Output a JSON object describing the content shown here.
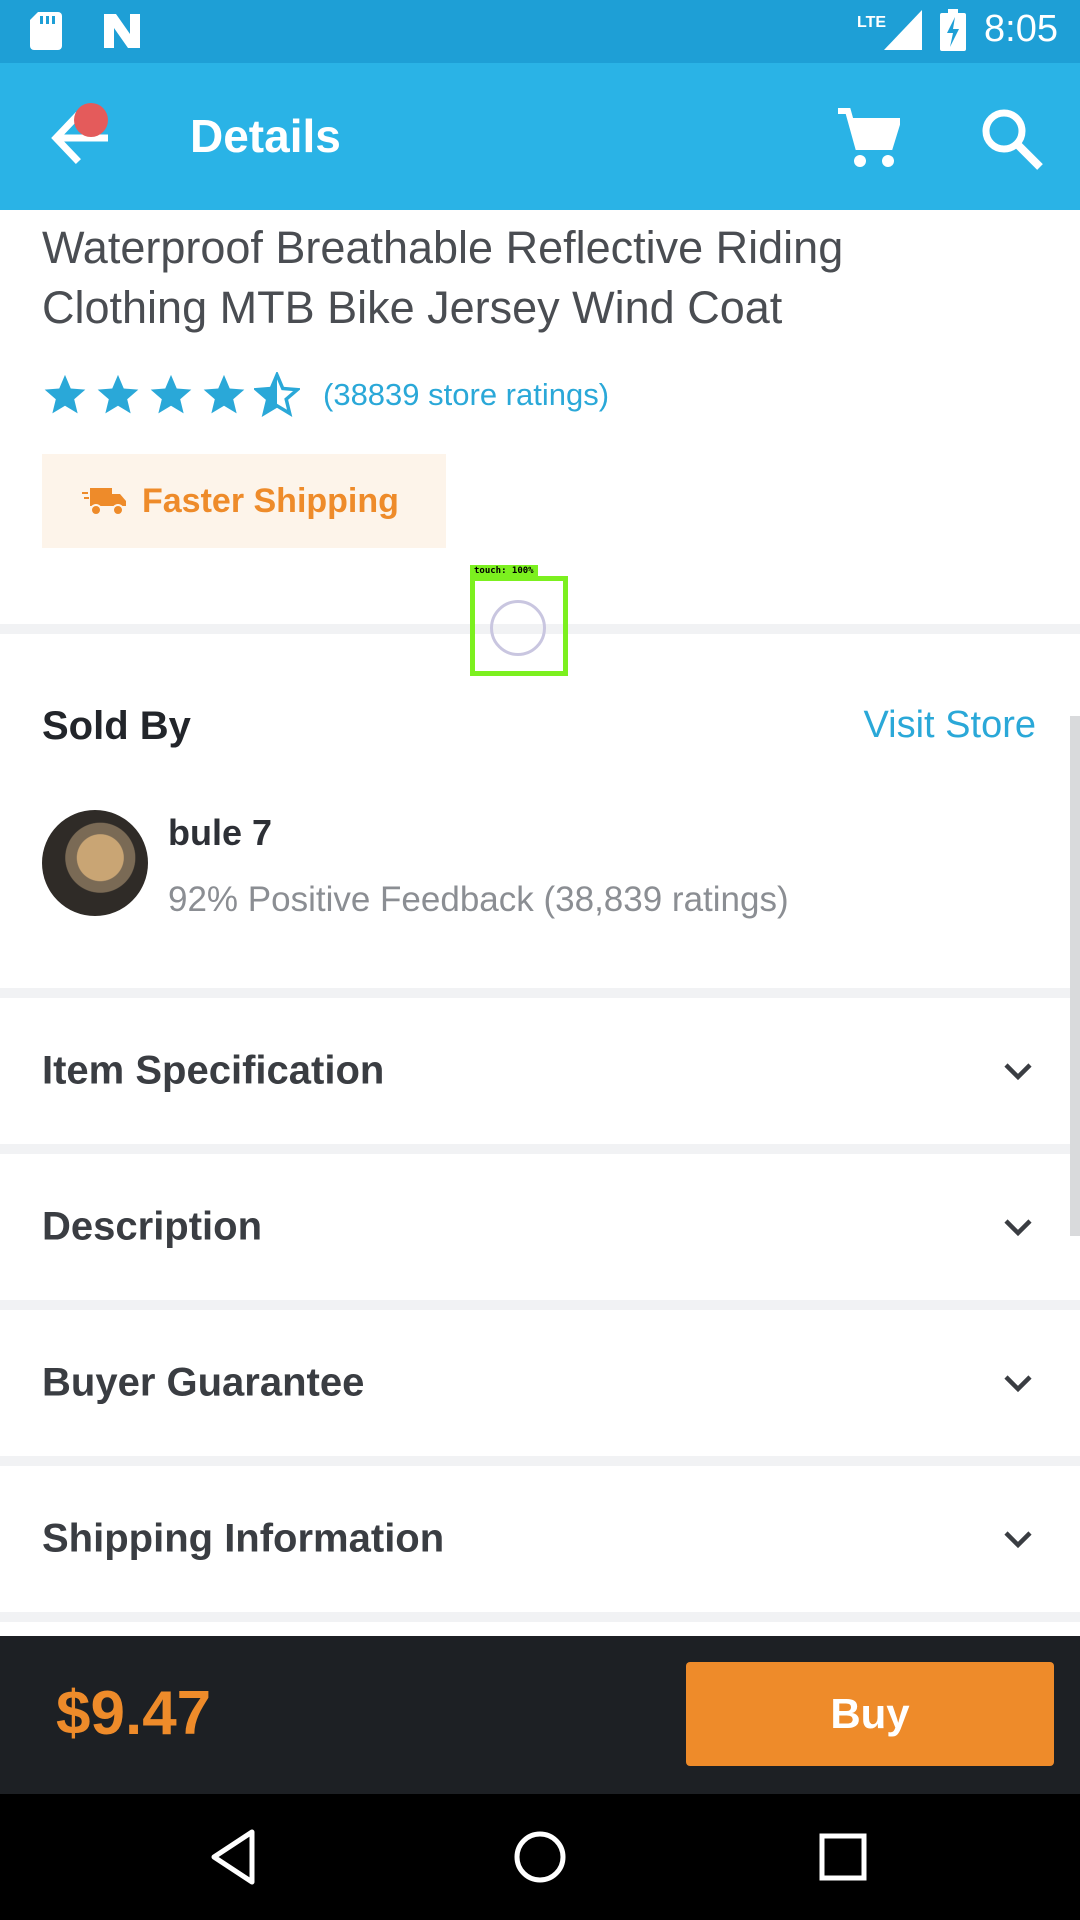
{
  "status_bar": {
    "time": "8:05",
    "network": "LTE",
    "icons": [
      "sd-card-icon",
      "app-notification-icon",
      "signal-icon",
      "battery-charging-icon"
    ]
  },
  "app_bar": {
    "title": "Details",
    "icons": [
      "back-arrow-icon",
      "cart-icon",
      "search-icon"
    ]
  },
  "product": {
    "title_line_1": "Waterproof Breathable Reflective Riding",
    "title_line_2": "Clothing MTB Bike Jersey Wind Coat",
    "rating": 4.5,
    "rating_count_text": "(38839 store ratings)",
    "shipping_badge": "Faster Shipping"
  },
  "overlay": {
    "touch_label": "touch: 100%"
  },
  "seller": {
    "section_title": "Sold By",
    "visit_store": "Visit Store",
    "name": "bule 7",
    "feedback": "92% Positive Feedback (38,839 ratings)"
  },
  "sections": [
    {
      "label": "Item Specification"
    },
    {
      "label": "Description"
    },
    {
      "label": "Buyer Guarantee"
    },
    {
      "label": "Shipping Information"
    }
  ],
  "purchase": {
    "price": "$9.47",
    "buy_label": "Buy"
  },
  "colors": {
    "status_bar": "#1e9fd6",
    "app_bar": "#2ab3e6",
    "accent_blue": "#2aa8d8",
    "accent_orange": "#ee8b2a",
    "bottom_bar": "#1d2024"
  }
}
